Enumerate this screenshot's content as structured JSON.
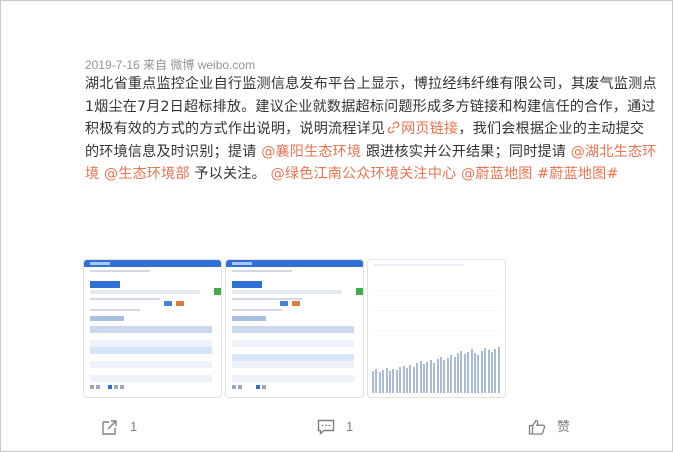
{
  "post": {
    "meta": "2019-7-16 来自 微博 weibo.com",
    "segments": [
      {
        "type": "text",
        "text": "湖北省重点监控企业自行监测信息发布平台上显示，博拉经纬纤维有限公司，其废气监测点1烟尘在7月2日超标排放。建议企业就数据超标问题形成多方链接和构建信任的合作，通过积极有效的方式的方式作出说明，说明流程详见"
      },
      {
        "type": "link",
        "text": "网页链接"
      },
      {
        "type": "text",
        "text": "，我们会根据企业的主动提交的环境信息及时识别；提请 "
      },
      {
        "type": "mention",
        "text": "@襄阳生态环境"
      },
      {
        "type": "text",
        "text": " 跟进核实并公开结果；同时提请 "
      },
      {
        "type": "mention",
        "text": "@湖北生态环境"
      },
      {
        "type": "text",
        "text": " "
      },
      {
        "type": "mention",
        "text": "@生态环境部"
      },
      {
        "type": "text",
        "text": " 予以关注。 "
      },
      {
        "type": "mention",
        "text": "@绿色江南公众环境关注中心"
      },
      {
        "type": "text",
        "text": " "
      },
      {
        "type": "mention",
        "text": "@蔚蓝地图"
      },
      {
        "type": "text",
        "text": " "
      },
      {
        "type": "mention",
        "text": "#蔚蓝地图#"
      }
    ]
  },
  "images": [
    {
      "name": "screenshot-monitoring-table-1"
    },
    {
      "name": "screenshot-monitoring-table-2"
    },
    {
      "name": "screenshot-emission-chart"
    }
  ],
  "actions": {
    "share_count": "1",
    "comment_count": "1",
    "like_label": "赞"
  },
  "icons": {
    "share": "share-icon",
    "comment": "comment-icon",
    "like": "like-icon",
    "link": "link-icon"
  },
  "colors": {
    "mention": "#eb7350",
    "text": "#333333",
    "meta": "#939393"
  }
}
